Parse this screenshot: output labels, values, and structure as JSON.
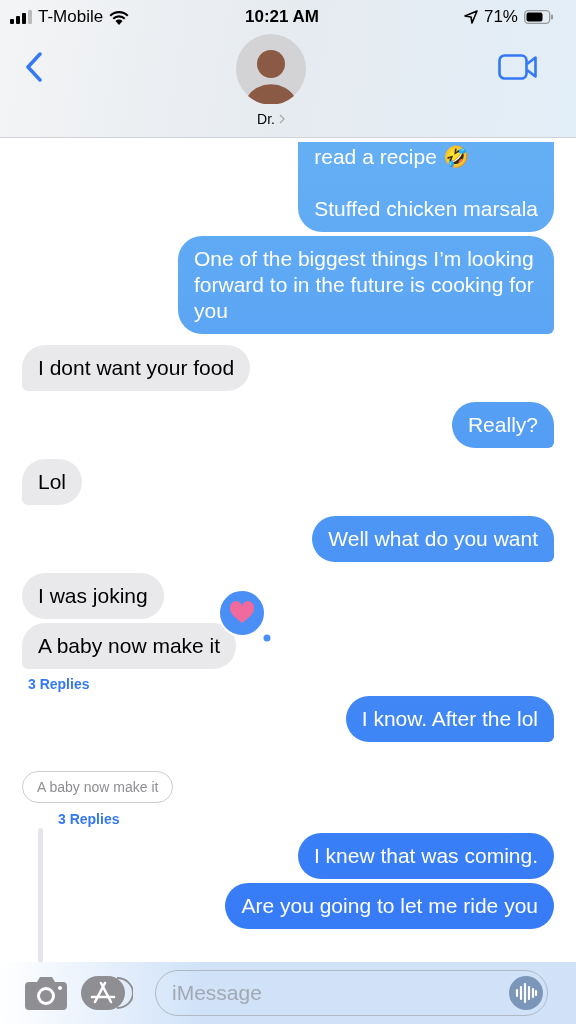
{
  "status_bar": {
    "carrier": "T-Mobile",
    "time": "10:21 AM",
    "battery": "71%"
  },
  "header": {
    "contact": "Dr."
  },
  "messages": [
    {
      "kind": "sent",
      "text": "read a recipe 🤣\n\nStuffed chicken marsala",
      "tail": false
    },
    {
      "kind": "sent",
      "text": "One of the biggest things I’m looking forward to in the future is cooking for you",
      "tail": true
    },
    {
      "kind": "received",
      "text": "I dont want your food",
      "tail": true
    },
    {
      "kind": "sent",
      "text": "Really?",
      "tail": true
    },
    {
      "kind": "received",
      "text": "Lol",
      "tail": true
    },
    {
      "kind": "sent",
      "text": "Well what do you want",
      "tail": true
    },
    {
      "kind": "received",
      "text": "I was joking",
      "tail": false
    },
    {
      "kind": "received",
      "text": "A baby now make it",
      "tail": true,
      "tapback": {
        "kind": "heart"
      }
    },
    {
      "kind": "replies",
      "text": "3 Replies"
    },
    {
      "kind": "sent",
      "text": "I know. After the lol",
      "tail": true
    },
    {
      "kind": "quote",
      "text": "A baby now make it"
    },
    {
      "kind": "thread-replies",
      "text": "3 Replies"
    },
    {
      "kind": "sent",
      "text": "I knew that was coming.",
      "tail": false
    },
    {
      "kind": "sent",
      "text": "Are you going to let me ride you",
      "tail": false
    }
  ],
  "composer": {
    "placeholder": "iMessage"
  }
}
